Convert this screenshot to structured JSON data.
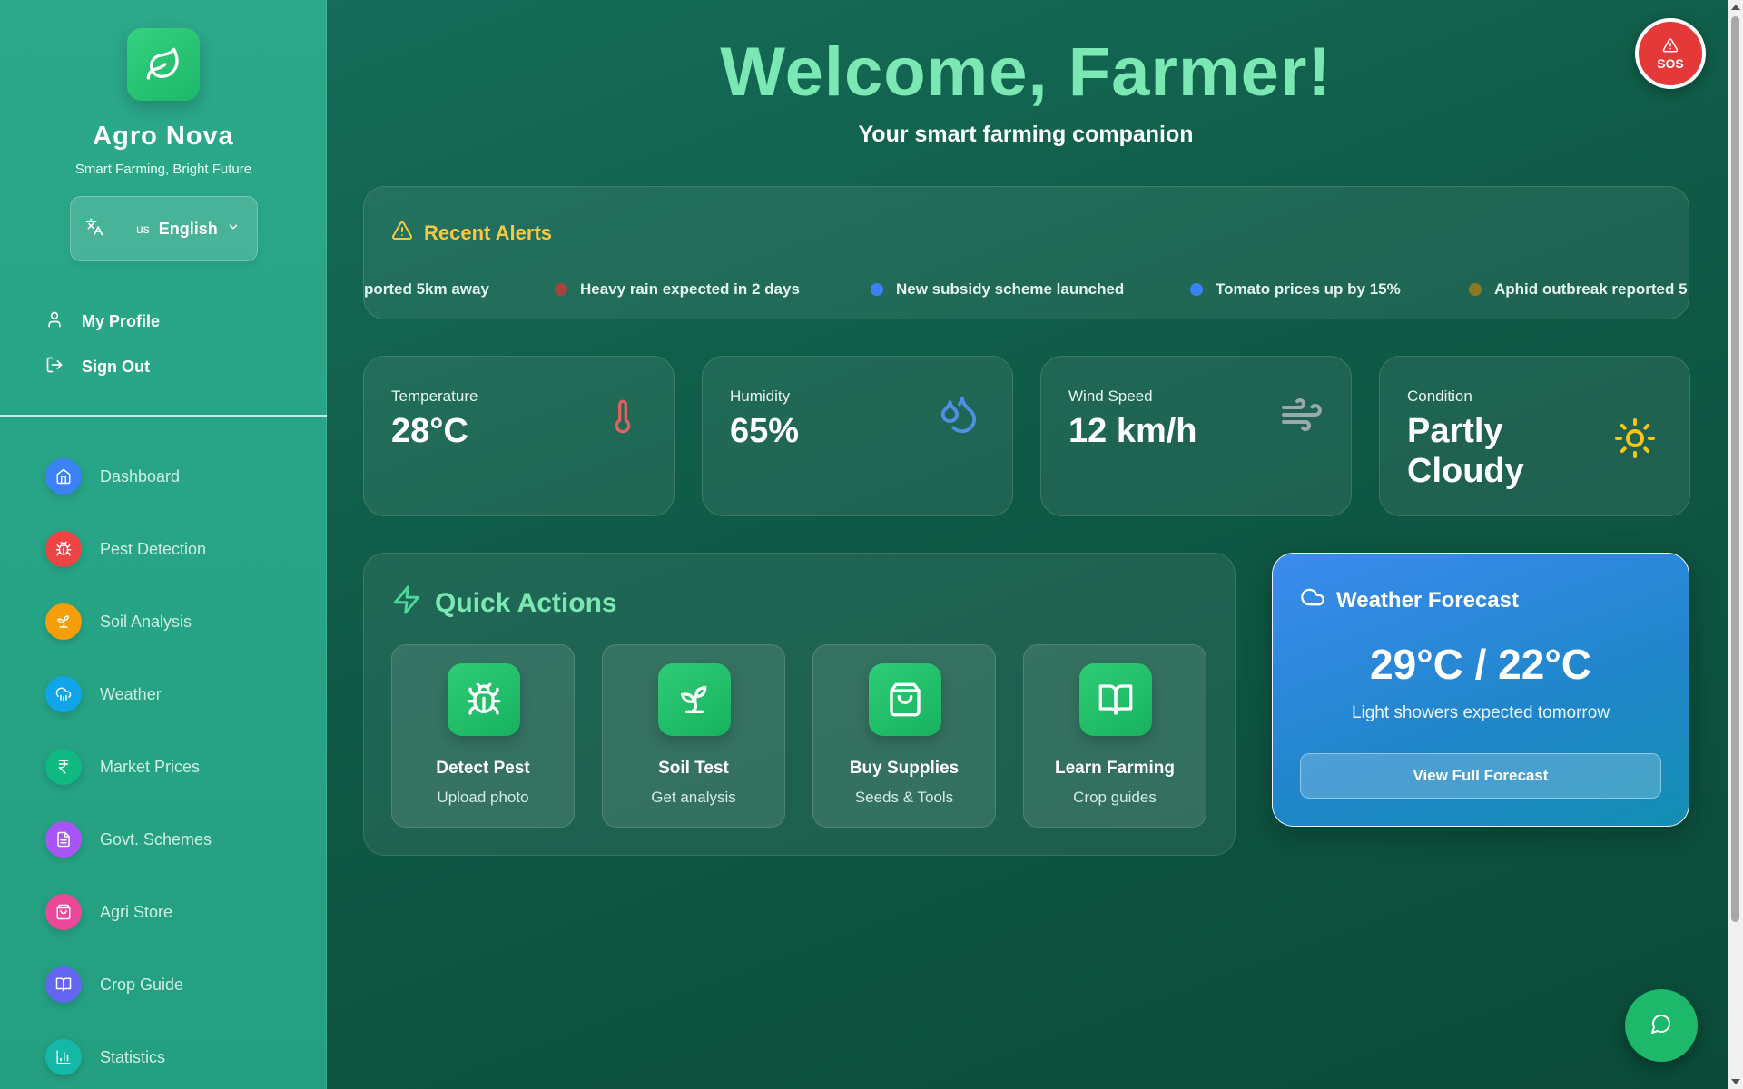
{
  "brand": {
    "name": "Agro Nova",
    "tagline": "Smart Farming, Bright Future",
    "logo_icon": "leaf-icon"
  },
  "language": {
    "flag_code": "us",
    "selected": "English",
    "icon": "translate-icon"
  },
  "account": {
    "profile_label": "My Profile",
    "signout_label": "Sign Out"
  },
  "nav": {
    "items": [
      {
        "label": "Dashboard",
        "icon": "home-icon",
        "color": "#3b82f6"
      },
      {
        "label": "Pest Detection",
        "icon": "bug-icon",
        "color": "#ef4444"
      },
      {
        "label": "Soil Analysis",
        "icon": "sprout-icon",
        "color": "#f59e0b"
      },
      {
        "label": "Weather",
        "icon": "cloud-rain-icon",
        "color": "#0ea5e9"
      },
      {
        "label": "Market Prices",
        "icon": "rupee-icon",
        "color": "#10b981"
      },
      {
        "label": "Govt. Schemes",
        "icon": "document-icon",
        "color": "#a855f7"
      },
      {
        "label": "Agri Store",
        "icon": "shopping-bag-icon",
        "color": "#ec4899"
      },
      {
        "label": "Crop Guide",
        "icon": "book-icon",
        "color": "#6366f1"
      },
      {
        "label": "Statistics",
        "icon": "bar-chart-icon",
        "color": "#14b8a6"
      }
    ]
  },
  "header": {
    "title": "Welcome, Farmer!",
    "subtitle": "Your smart farming companion"
  },
  "sos": {
    "label": "SOS"
  },
  "alerts": {
    "title": "Recent Alerts",
    "items": [
      {
        "text": "ported 5km away",
        "color": null
      },
      {
        "text": "Heavy rain expected in 2 days",
        "color": "#a4433f"
      },
      {
        "text": "New subsidy scheme launched",
        "color": "#3b82f6"
      },
      {
        "text": "Tomato prices up by 15%",
        "color": "#3b82f6"
      },
      {
        "text": "Aphid outbreak reported 5",
        "color": "#8b7a23"
      }
    ]
  },
  "stats": [
    {
      "label": "Temperature",
      "value": "28°C",
      "icon": "thermometer-icon",
      "color": "#e26262"
    },
    {
      "label": "Humidity",
      "value": "65%",
      "icon": "droplets-icon",
      "color": "#4f8fe6"
    },
    {
      "label": "Wind Speed",
      "value": "12 km/h",
      "icon": "wind-icon",
      "color": "#9aa8b0"
    },
    {
      "label": "Condition",
      "value": "Partly Cloudy",
      "icon": "sun-icon",
      "color": "#f5c518"
    }
  ],
  "quick_actions": {
    "title": "Quick Actions",
    "items": [
      {
        "title": "Detect Pest",
        "subtitle": "Upload photo",
        "icon": "bug-icon"
      },
      {
        "title": "Soil Test",
        "subtitle": "Get analysis",
        "icon": "sprout-icon"
      },
      {
        "title": "Buy Supplies",
        "subtitle": "Seeds & Tools",
        "icon": "shopping-bag-icon"
      },
      {
        "title": "Learn Farming",
        "subtitle": "Crop guides",
        "icon": "book-icon"
      }
    ]
  },
  "forecast": {
    "title": "Weather Forecast",
    "temps": "29°C / 22°C",
    "description": "Light showers expected tomorrow",
    "button": "View Full Forecast"
  },
  "chat": {
    "icon": "chat-bubble-icon"
  }
}
